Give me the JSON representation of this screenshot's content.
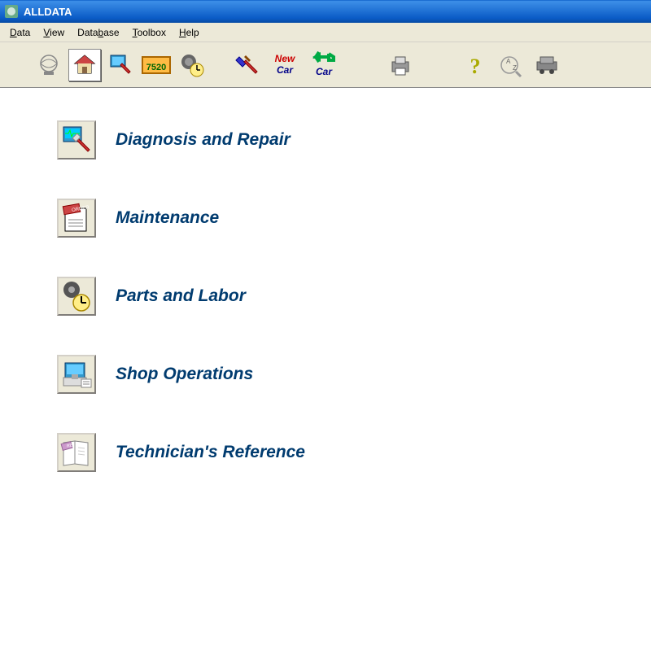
{
  "titlebar": {
    "title": "ALLDATA"
  },
  "menubar": {
    "items": [
      {
        "label": "Data",
        "hotkey": "D"
      },
      {
        "label": "View",
        "hotkey": "V"
      },
      {
        "label": "Database",
        "hotkey": "b"
      },
      {
        "label": "Toolbox",
        "hotkey": "T"
      },
      {
        "label": "Help",
        "hotkey": "H"
      }
    ]
  },
  "toolbar": {
    "buttons": [
      {
        "name": "logo-icon",
        "active": false
      },
      {
        "name": "home-icon",
        "active": true
      },
      {
        "name": "globe-hammer-icon",
        "active": false
      },
      {
        "name": "7520-icon",
        "active": false
      },
      {
        "name": "gear-clock-icon",
        "active": false
      }
    ],
    "group2": [
      {
        "name": "hammer-icon"
      },
      {
        "name": "new-car-icon",
        "text": "New\nCar"
      },
      {
        "name": "back-car-icon",
        "text": "Car"
      }
    ],
    "group3": [
      {
        "name": "print-icon"
      }
    ],
    "group4": [
      {
        "name": "help-icon"
      },
      {
        "name": "az-sort-icon"
      },
      {
        "name": "vehicle-icon"
      }
    ]
  },
  "main": {
    "items": [
      {
        "icon": "diagnosis-icon",
        "label": "Diagnosis and Repair"
      },
      {
        "icon": "maintenance-icon",
        "label": "Maintenance"
      },
      {
        "icon": "parts-labor-icon",
        "label": "Parts and Labor"
      },
      {
        "icon": "shop-ops-icon",
        "label": "Shop Operations"
      },
      {
        "icon": "reference-icon",
        "label": "Technician's Reference"
      }
    ]
  }
}
